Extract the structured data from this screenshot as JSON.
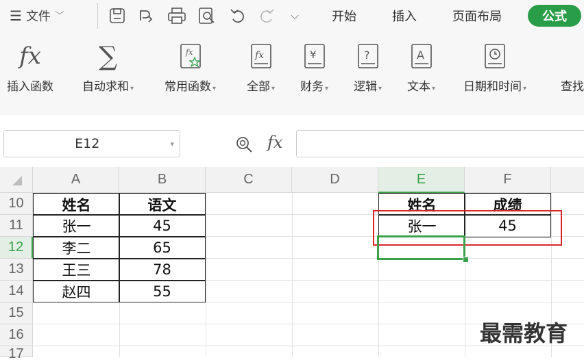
{
  "menu": {
    "file_label": "文件",
    "tabs": [
      "开始",
      "插入",
      "页面布局"
    ],
    "active_tab": "公式"
  },
  "ribbon": {
    "items": [
      {
        "label": "插入函数",
        "icon": "fx-icon",
        "dropdown": false
      },
      {
        "label": "自动求和",
        "icon": "sigma-icon",
        "dropdown": true
      },
      {
        "label": "常用函数",
        "icon": "star-function-icon",
        "dropdown": true
      },
      {
        "label": "全部",
        "icon": "fx-book-icon",
        "dropdown": true
      },
      {
        "label": "财务",
        "icon": "yen-book-icon",
        "dropdown": true
      },
      {
        "label": "逻辑",
        "icon": "question-book-icon",
        "dropdown": true
      },
      {
        "label": "文本",
        "icon": "text-book-icon",
        "dropdown": true
      },
      {
        "label": "日期和时间",
        "icon": "clock-book-icon",
        "dropdown": true
      },
      {
        "label": "查找",
        "icon": "",
        "dropdown": false
      }
    ]
  },
  "formula_bar": {
    "name_box": "E12",
    "fx_label": "fx",
    "formula": ""
  },
  "columns": [
    "A",
    "B",
    "C",
    "D",
    "E",
    "F"
  ],
  "rows": [
    "10",
    "11",
    "12",
    "13",
    "14",
    "15",
    "16",
    "17"
  ],
  "table1": {
    "headers": [
      "姓名",
      "语文"
    ],
    "rows": [
      [
        "张一",
        "45"
      ],
      [
        "李二",
        "65"
      ],
      [
        "王三",
        "78"
      ],
      [
        "赵四",
        "55"
      ]
    ]
  },
  "table2": {
    "headers": [
      "姓名",
      "成绩"
    ],
    "row": [
      "张一",
      "45"
    ]
  },
  "watermark": "最需教育",
  "colors": {
    "accent": "#2a9d49",
    "highlight": "#d9252a",
    "selection": "#3aa04a"
  }
}
